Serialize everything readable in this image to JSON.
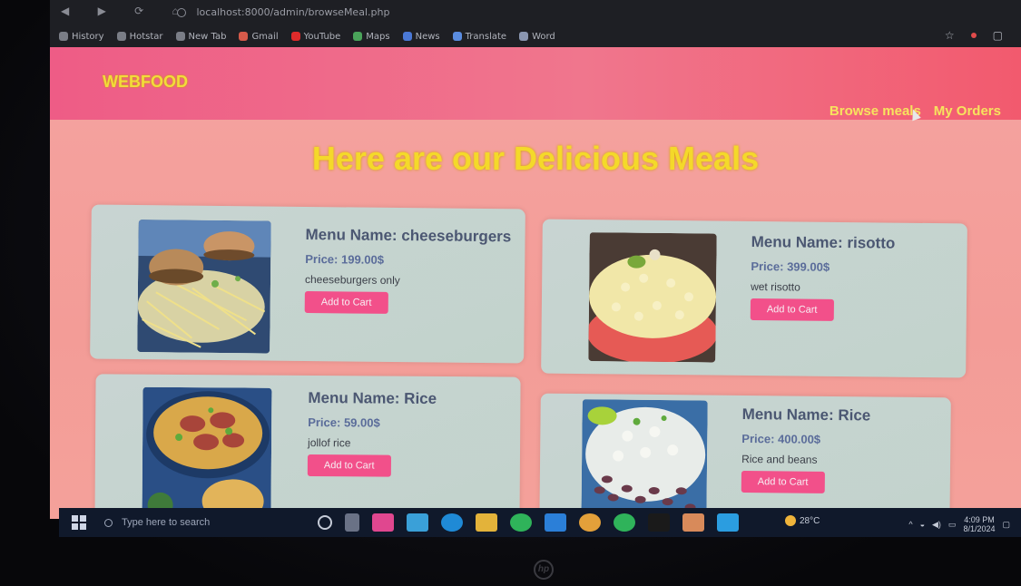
{
  "browser": {
    "url": "localhost:8000/admin/browseMeal.php",
    "bookmarks": [
      "History",
      "Hotstar",
      "New Tab",
      "Gmail",
      "YouTube",
      "Maps",
      "News",
      "Translate",
      "Word"
    ]
  },
  "site": {
    "brand": "WEBFOOD",
    "nav": {
      "browse": "Browse meals",
      "orders": "My Orders"
    },
    "headline": "Here are our Delicious Meals"
  },
  "meals": [
    {
      "name": "Menu Name: cheeseburgers",
      "price": "Price: 199.00$",
      "desc": "cheeseburgers only",
      "button": "Add to Cart"
    },
    {
      "name": "Menu Name: risotto",
      "price": "Price: 399.00$",
      "desc": "wet risotto",
      "button": "Add to Cart"
    },
    {
      "name": "Menu Name: Rice",
      "price": "Price: 59.00$",
      "desc": "jollof rice",
      "button": "Add to Cart"
    },
    {
      "name": "Menu Name: Rice",
      "price": "Price: 400.00$",
      "desc": "Rice and beans",
      "button": "Add to Cart"
    }
  ],
  "taskbar": {
    "search_placeholder": "Type here to search",
    "weather": "28°C",
    "time": "4:09 PM",
    "date": "8/1/2024"
  },
  "colors": {
    "page_bg": "#f5a3a0",
    "nav_bg": "#ee5c86",
    "accent_yellow": "#f4d92a",
    "card_bg": "#c8d4d2",
    "button": "#f2508a"
  }
}
